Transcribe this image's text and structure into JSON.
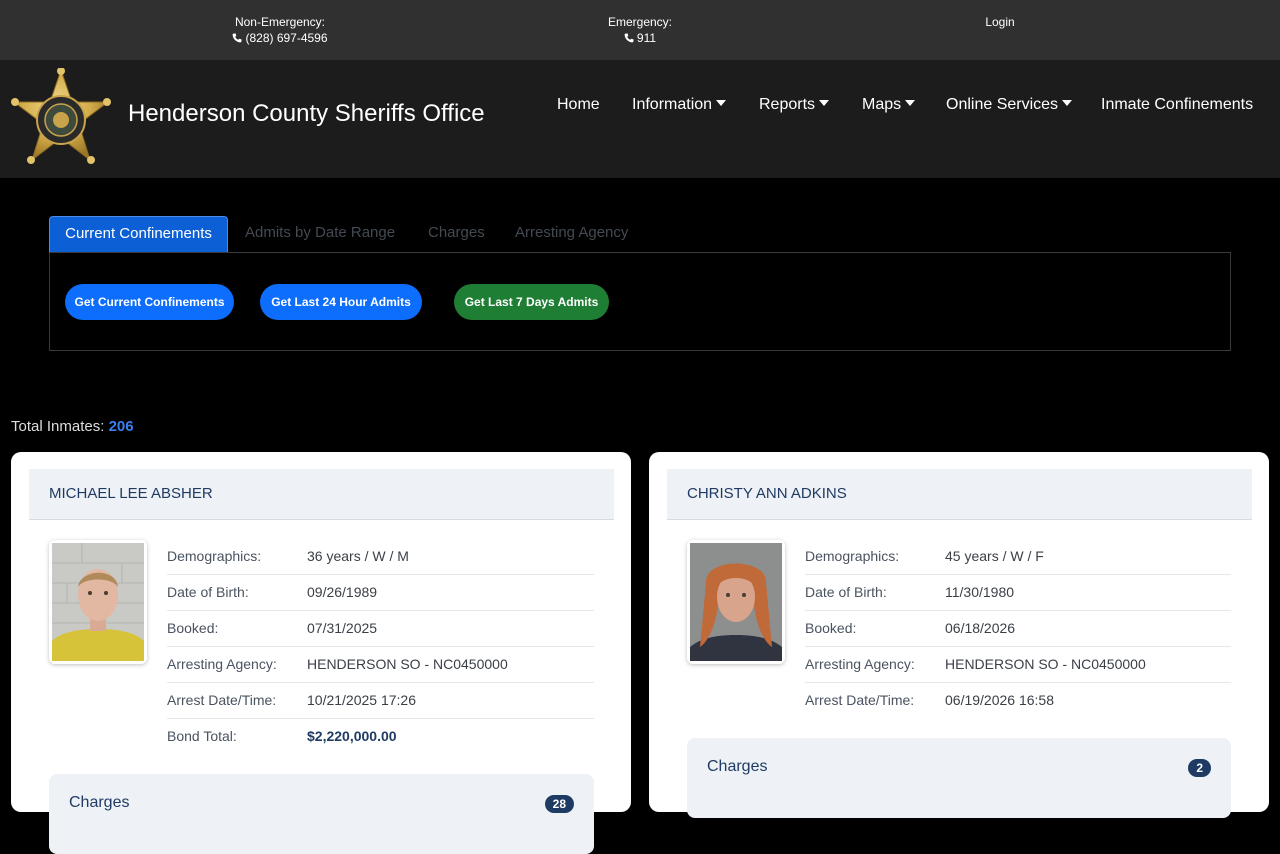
{
  "topbar": {
    "non_emergency_label": "Non-Emergency:",
    "non_emergency_phone": "(828) 697-4596",
    "emergency_label": "Emergency:",
    "emergency_phone": "911",
    "login": "Login"
  },
  "header": {
    "title": "Henderson County Sheriffs Office",
    "nav": {
      "home": "Home",
      "information": "Information",
      "reports": "Reports",
      "maps": "Maps",
      "online_services": "Online Services",
      "inmate_confinements": "Inmate Confinements"
    }
  },
  "tabs": {
    "current": "Current Confinements",
    "admits": "Admits by Date Range",
    "charges": "Charges",
    "agency": "Arresting Agency"
  },
  "buttons": {
    "current": "Get Current Confinements",
    "last24": "Get Last 24 Hour Admits",
    "last7": "Get Last 7 Days Admits"
  },
  "summary": {
    "label": "Total Inmates:",
    "count": "206"
  },
  "colors": {
    "primary": "#0d6efd",
    "success": "#1e7e34",
    "navy": "#1f3b63"
  },
  "inmates": [
    {
      "name": "MICHAEL LEE ABSHER",
      "fields": [
        {
          "label": "Demographics:",
          "value": "36 years / W / M"
        },
        {
          "label": "Date of Birth:",
          "value": "09/26/1989"
        },
        {
          "label": "Booked:",
          "value": "07/31/2025"
        },
        {
          "label": "Arresting Agency:",
          "value": "HENDERSON SO - NC0450000"
        },
        {
          "label": "Arrest Date/Time:",
          "value": "10/21/2025 17:26"
        },
        {
          "label": "Bond Total:",
          "value": "$2,220,000.00"
        }
      ],
      "charges_label": "Charges",
      "charges_count": "28"
    },
    {
      "name": "CHRISTY ANN ADKINS",
      "fields": [
        {
          "label": "Demographics:",
          "value": "45 years / W / F"
        },
        {
          "label": "Date of Birth:",
          "value": "11/30/1980"
        },
        {
          "label": "Booked:",
          "value": "06/18/2026"
        },
        {
          "label": "Arresting Agency:",
          "value": "HENDERSON SO - NC0450000"
        },
        {
          "label": "Arrest Date/Time:",
          "value": "06/19/2026 16:58"
        }
      ],
      "charges_label": "Charges",
      "charges_count": "2"
    }
  ]
}
